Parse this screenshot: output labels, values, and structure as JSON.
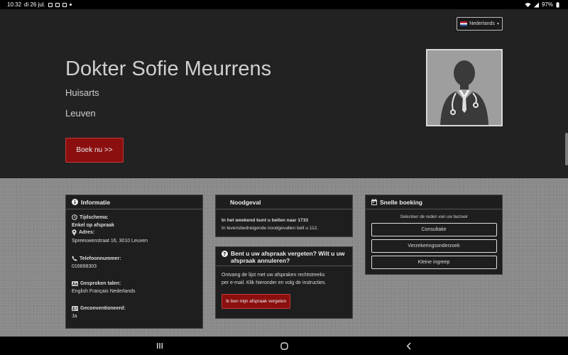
{
  "status_bar": {
    "time": "10:32",
    "date": "di 26 jul.",
    "battery": "97%"
  },
  "header": {
    "language": "Nederlands",
    "name": "Dokter Sofie Meurrens",
    "specialty": "Huisarts",
    "city": "Leuven",
    "book_button": "Boek nu >>"
  },
  "info": {
    "title": "Informatie",
    "schedule_label": "Tijdschema:",
    "schedule_value": "Enkel op afspraak",
    "address_label": "Adres:",
    "address_value": "Spreeuwenstraat 16, 3010 Leuven",
    "phone_label": "Telefoonnummer:",
    "phone_value": "016898303",
    "languages_label": "Gesproken talen:",
    "languages_value": "English Français Nederlands",
    "convention_label": "Geconventioneerd:",
    "convention_value": "Ja"
  },
  "emergency": {
    "title": "Noodgeval",
    "line1": "In het weekend kunt u bellen naar 1733",
    "line2": "In levensbedreigende noodgevallen belt u 112."
  },
  "forgot": {
    "title_line1": "Bent u uw afspraak vergeten? Wilt u uw",
    "title_line2": "afspraak annuleren?",
    "text_line1": "Ontvang de lijst met uw afspraken rechtstreeks",
    "text_line2": "per e-mail. Klik hieronder en volg de instructies.",
    "button": "Ik ben mijn afspraak vergeten"
  },
  "quick_booking": {
    "title": "Snelle boeking",
    "subtitle": "Selecteer de reden van uw bezoek",
    "reasons": [
      "Consultatie",
      "Verzekeringsonderzoek",
      "Kleine ingreep"
    ]
  },
  "colors": {
    "hero_bg": "#222222",
    "accent_red": "#8b0f0f",
    "card_bg": "#1e1e1e"
  }
}
